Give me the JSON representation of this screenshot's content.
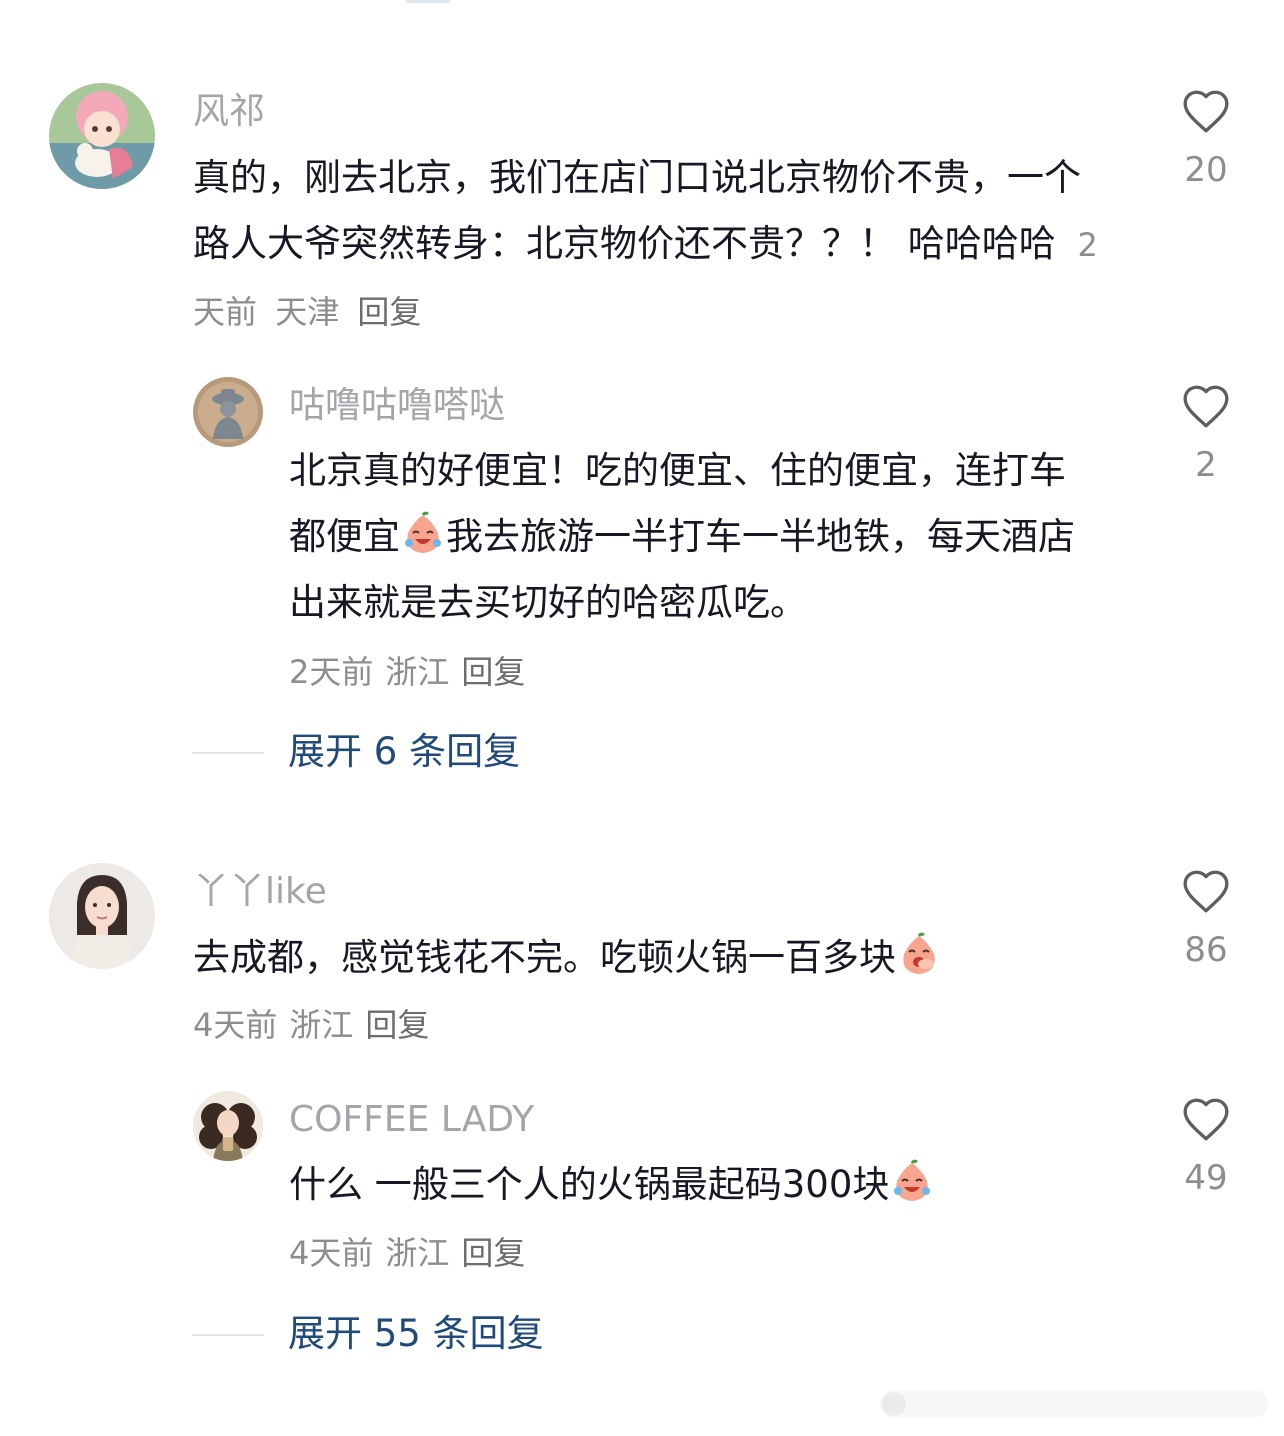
{
  "comments": [
    {
      "username": "风祁",
      "text_part1": "真的，刚去北京，我们在店门口说北京物价不贵，一个路人大爷突然转身：北京物价还不贵？？！ 哈哈哈哈",
      "time": "2天前",
      "location": "天津",
      "reply_label": "回复",
      "likes": "20",
      "avatar_icon": "anime-girl-avatar"
    },
    {
      "username": "咕噜咕噜嗒哒",
      "text_part1": "北京真的好便宜！吃的便宜、住的便宜，连打车都便宜",
      "emoji": "crying-laugh-emoji",
      "text_part2": "我去旅游一半打车一半地铁，每天酒店出来就是去买切好的哈密瓜吃。",
      "time": "2天前",
      "location": "浙江",
      "reply_label": "回复",
      "likes": "2",
      "avatar_icon": "statue-avatar"
    },
    {
      "username": "丫丫like",
      "text_part1": "去成都，感觉钱花不完。吃顿火锅一百多块",
      "emoji": "shy-laugh-emoji",
      "time": "4天前",
      "location": "浙江",
      "reply_label": "回复",
      "likes": "86",
      "avatar_icon": "woman-avatar"
    },
    {
      "username": "COFFEE LADY",
      "text_part1": "什么 一般三个人的火锅最起码300块",
      "emoji": "crying-laugh-emoji",
      "time": "4天前",
      "location": "浙江",
      "reply_label": "回复",
      "likes": "49",
      "avatar_icon": "coffee-girl-avatar"
    }
  ],
  "expand": [
    {
      "label": "展开 6 条回复"
    },
    {
      "label": "展开 55 条回复"
    }
  ],
  "colors": {
    "username": "#a3a5ab",
    "text": "#161823",
    "meta": "#8b8d92",
    "expand": "#1f4a7a"
  }
}
